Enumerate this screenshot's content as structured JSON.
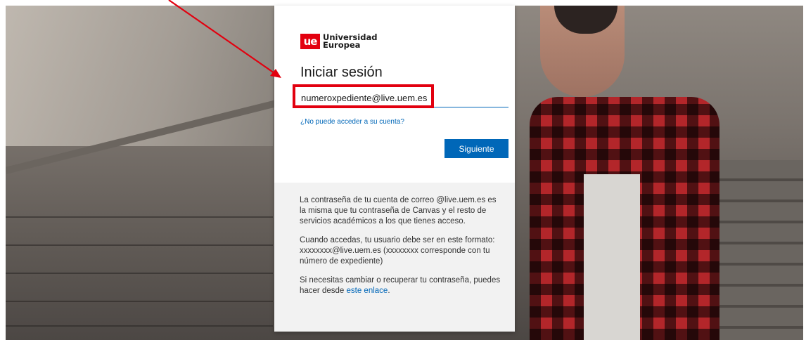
{
  "logo": {
    "mark": "ue",
    "line1": "Universidad",
    "line2": "Europea"
  },
  "signin": {
    "title": "Iniciar sesión",
    "email_value": "numeroxpediente@live.uem.es",
    "cant_access_link": "¿No puede acceder a su cuenta?",
    "next_button": "Siguiente"
  },
  "info": {
    "paragraph1": "La contraseña de tu cuenta de correo @live.uem.es es la misma que tu contraseña de Canvas y el resto de servicios académicos a los que tienes acceso.",
    "paragraph2": "Cuando accedas, tu usuario debe ser en este formato: xxxxxxxx@live.uem.es (xxxxxxxx corresponde con tu número de expediente)",
    "paragraph3_text": "Si necesitas cambiar o recuperar tu contraseña, puedes hacer desde ",
    "paragraph3_link": "este enlace",
    "paragraph3_end": "."
  },
  "colors": {
    "brand_red": "#e3000f",
    "accent_blue": "#0067b8",
    "annotation_red": "#e2000f"
  }
}
